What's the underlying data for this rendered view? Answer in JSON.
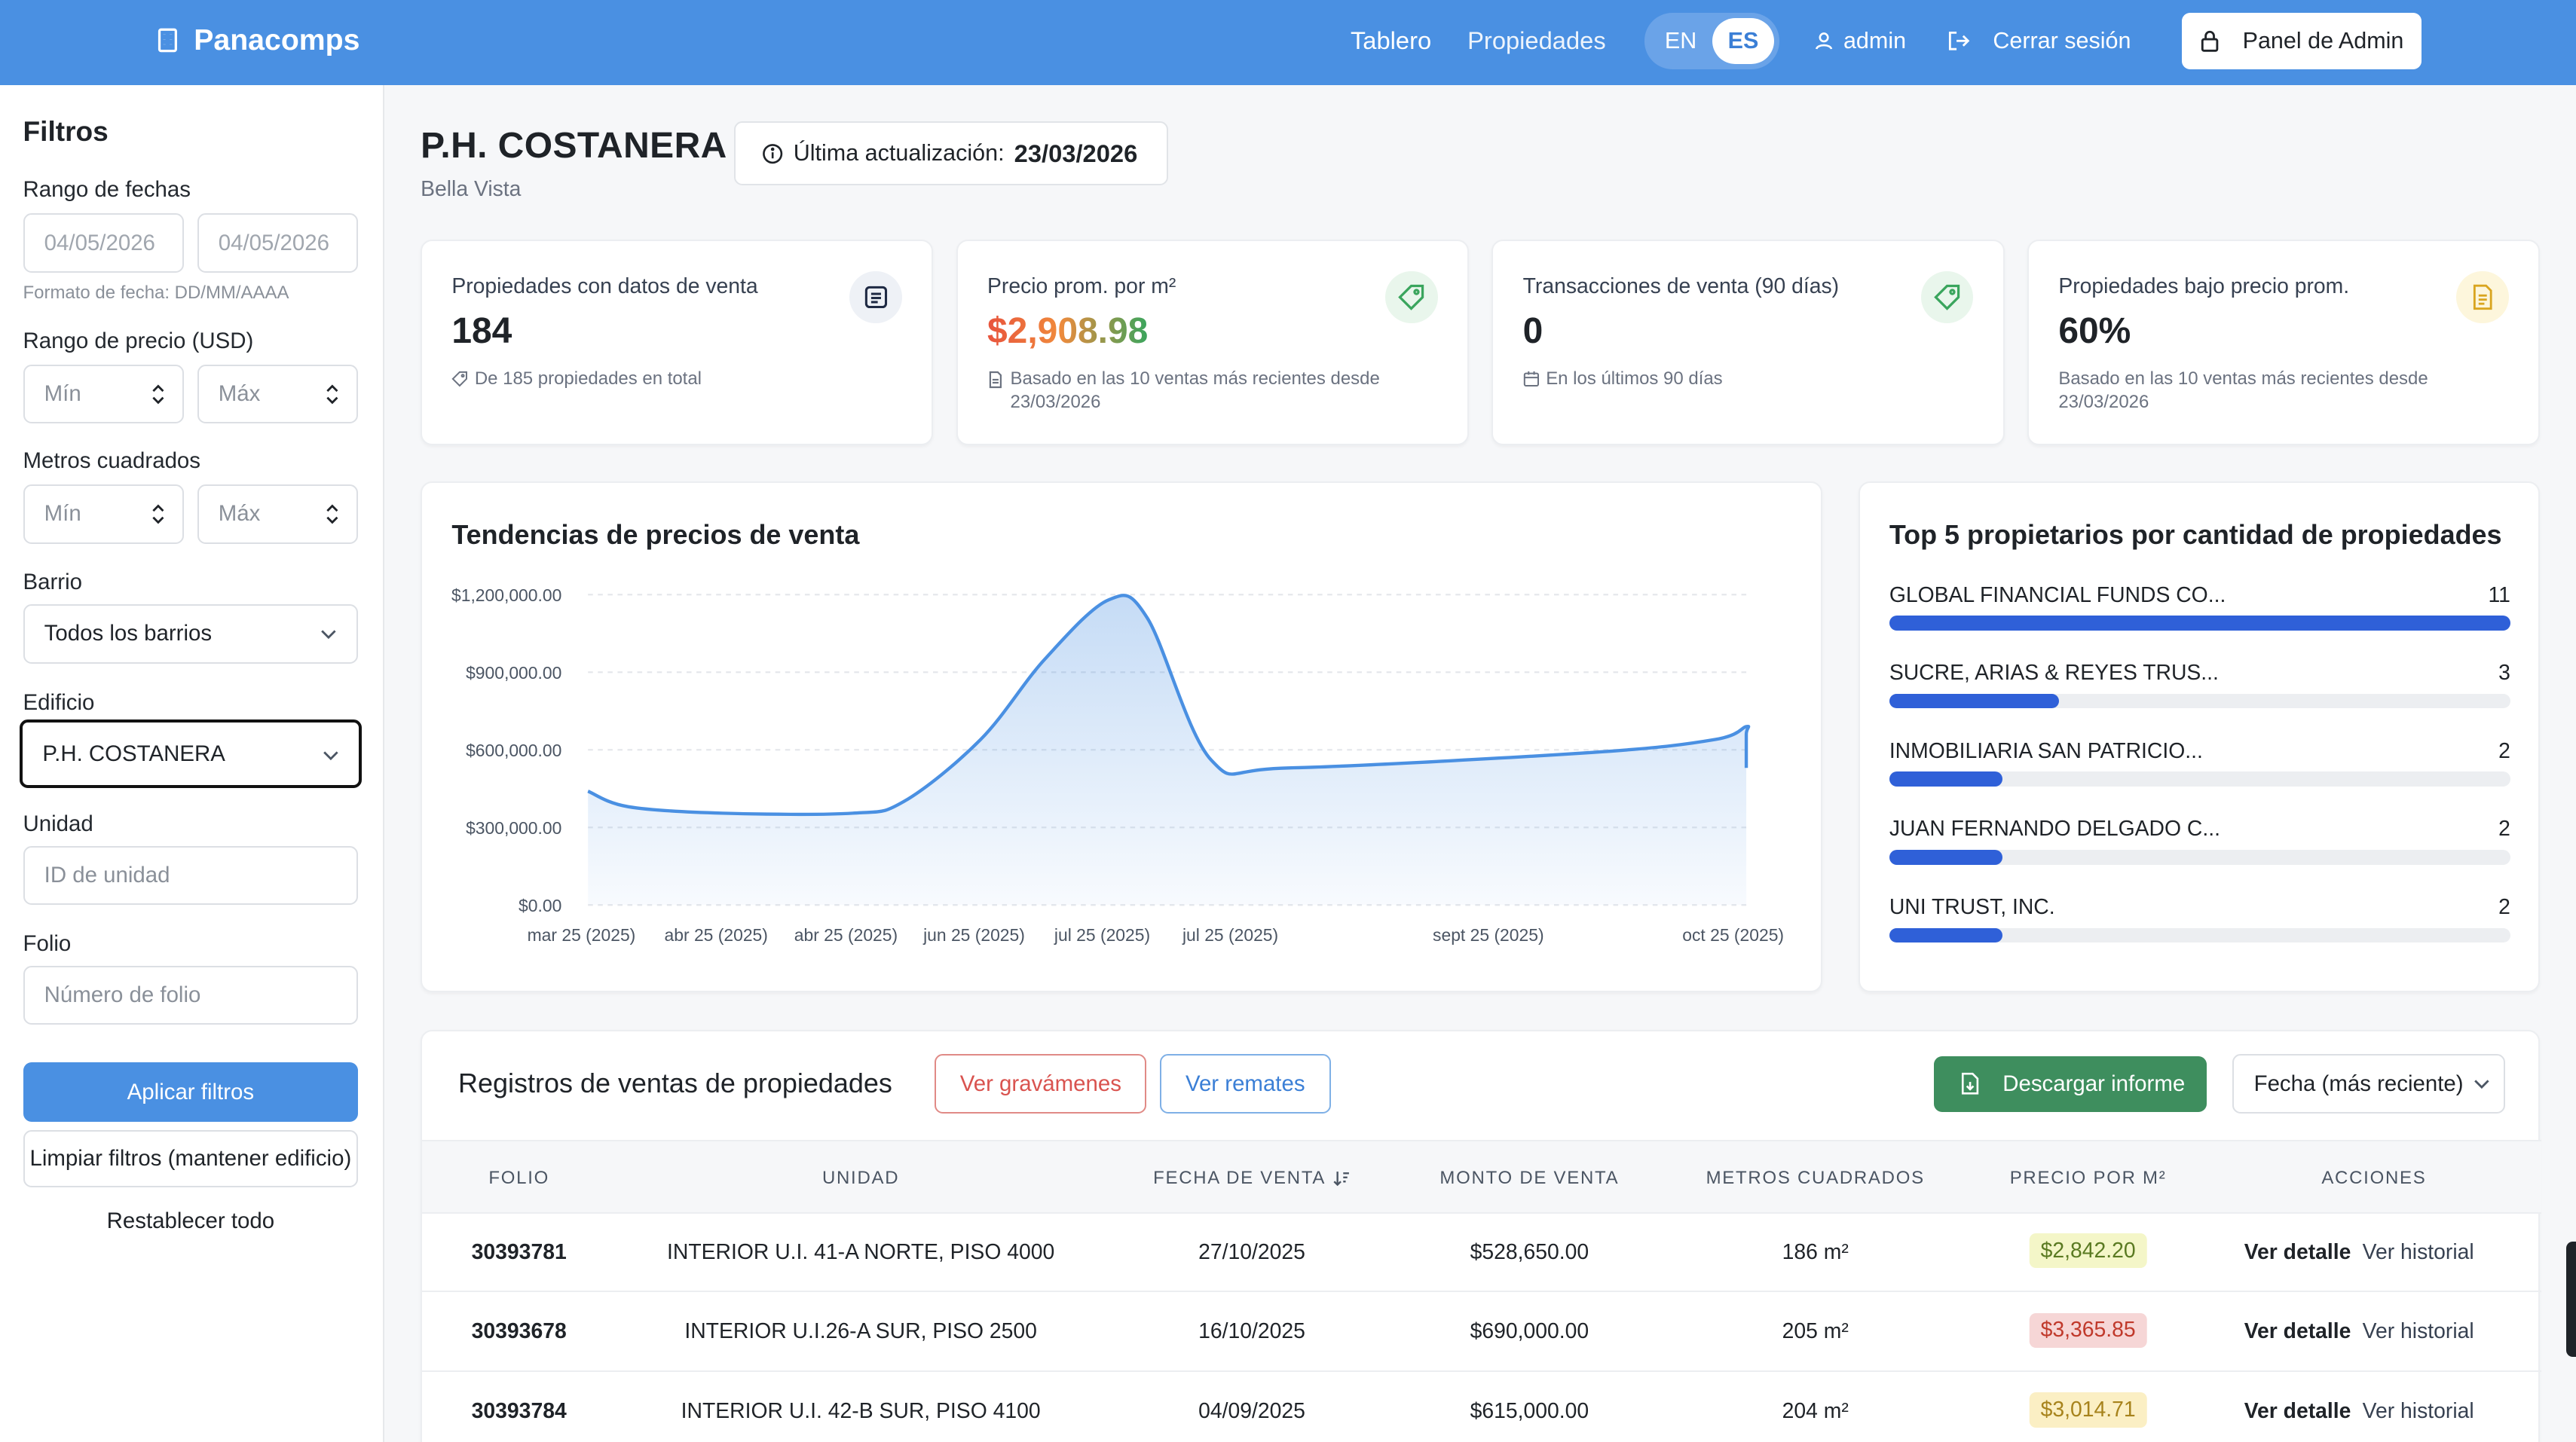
{
  "header": {
    "brand": "Panacomps",
    "nav": [
      "Tablero",
      "Propiedades"
    ],
    "lang": [
      "EN",
      "ES"
    ],
    "lang_active": "ES",
    "user": "admin",
    "logout": "Cerrar sesión",
    "admin_button": "Panel de Admin"
  },
  "filters": {
    "title": "Filtros",
    "date_range_label": "Rango de fechas",
    "date_from_placeholder": "04/05/2026",
    "date_to_placeholder": "04/05/2026",
    "date_hint": "Formato de fecha: DD/MM/AAAA",
    "price_label": "Rango de precio (USD)",
    "min_placeholder": "Mín",
    "max_placeholder": "Máx",
    "sqm_label": "Metros cuadrados",
    "barrio_label": "Barrio",
    "barrio_value": "Todos los barrios",
    "edificio_label": "Edificio",
    "edificio_value": "P.H. COSTANERA",
    "unidad_label": "Unidad",
    "unidad_placeholder": "ID de unidad",
    "folio_label": "Folio",
    "folio_placeholder": "Número de folio",
    "apply": "Aplicar filtros",
    "clear": "Limpiar filtros (mantener edificio)",
    "reset": "Restablecer todo"
  },
  "property": {
    "title": "P.H. COSTANERA",
    "subtitle": "Bella Vista",
    "update_label": "Última actualización:",
    "update_date": "23/03/2026"
  },
  "stats": [
    {
      "label": "Propiedades con datos de venta",
      "value": "184",
      "note": "De 185 propiedades en total"
    },
    {
      "label": "Precio prom. por m²",
      "value": "$2,908.98",
      "note": "Basado en las 10 ventas más recientes desde 23/03/2026"
    },
    {
      "label": "Transacciones de venta (90 días)",
      "value": "0",
      "note": "En los últimos 90 días"
    },
    {
      "label": "Propiedades bajo precio prom.",
      "value": "60%",
      "note": "Basado en las 10 ventas más recientes desde 23/03/2026"
    }
  ],
  "colors": {
    "header_bg": "#4a90e2",
    "price_gradient_start": "#e8543d",
    "price_gradient_end": "#3aa55d",
    "chart_line": "#4a90e2",
    "owner_bar": "#2f60d8",
    "download_button": "#3e8e5e",
    "liens_button": "#d9534f",
    "auctions_button": "#3b7fd6"
  },
  "chart_data": {
    "type": "area",
    "title": "Tendencias de precios de venta",
    "categories": [
      "mar 25 (2025)",
      "abr 25 (2025)",
      "abr 25 (2025)",
      "jun 25 (2025)",
      "jul 25 (2025)",
      "jul 25 (2025)",
      "sept 25 (2025)",
      "oct 25 (2025)"
    ],
    "x_tick_labels": [
      "mar 25 (2025)",
      "abr 25 (2025)",
      "abr 25 (2025)",
      "jun 25 (2025)",
      "jul 25 (2025)",
      "jul 25 (2025)",
      "sept 25 (2025)",
      "oct 25 (2025)"
    ],
    "y_tick_labels": [
      "$0.00",
      "$300,000.00",
      "$600,000.00",
      "$900,000.00",
      "$1,200,000.00"
    ],
    "ylim": [
      0,
      1200000
    ],
    "points": [
      {
        "x_index": 0,
        "y": 440000
      },
      {
        "x_index": 0.3,
        "y": 380000
      },
      {
        "x_index": 1,
        "y": 355000
      },
      {
        "x_index": 2,
        "y": 355000
      },
      {
        "x_index": 2.4,
        "y": 400000
      },
      {
        "x_index": 3,
        "y": 640000
      },
      {
        "x_index": 3.5,
        "y": 950000
      },
      {
        "x_index": 4,
        "y": 1180000
      },
      {
        "x_index": 4.3,
        "y": 1110000
      },
      {
        "x_index": 4.8,
        "y": 560000
      },
      {
        "x_index": 5.2,
        "y": 530000
      },
      {
        "x_index": 6.4,
        "y": 590000
      },
      {
        "x_index": 6.9,
        "y": 640000
      },
      {
        "x_index": 7.3,
        "y": 690000
      },
      {
        "x_index": 7.6,
        "y": 660000
      },
      {
        "x_index": 8.1,
        "y": 530000
      }
    ],
    "grid": true
  },
  "owners": {
    "title": "Top 5 propietarios por cantidad de propiedades",
    "items": [
      {
        "name": "GLOBAL FINANCIAL FUNDS CO...",
        "count": 11
      },
      {
        "name": "SUCRE, ARIAS & REYES TRUS...",
        "count": 3
      },
      {
        "name": "INMOBILIARIA SAN PATRICIO...",
        "count": 2
      },
      {
        "name": "JUAN FERNANDO DELGADO C...",
        "count": 2
      },
      {
        "name": "UNI TRUST, INC.",
        "count": 2
      }
    ]
  },
  "records": {
    "title": "Registros de ventas de propiedades",
    "liens": "Ver gravámenes",
    "auctions": "Ver remates",
    "download": "Descargar informe",
    "sort": "Fecha (más reciente)",
    "columns": [
      "FOLIO",
      "UNIDAD",
      "FECHA DE VENTA",
      "MONTO DE VENTA",
      "METROS CUADRADOS",
      "PRECIO POR M²",
      "ACCIONES"
    ],
    "rows": [
      {
        "folio": "30393781",
        "unidad": "INTERIOR U.I. 41-A NORTE, PISO 4000",
        "fecha": "27/10/2025",
        "monto": "$528,650.00",
        "m2": "186 m²",
        "precio": "$2,842.20",
        "tone": "green"
      },
      {
        "folio": "30393678",
        "unidad": "INTERIOR U.I.26-A SUR, PISO 2500",
        "fecha": "16/10/2025",
        "monto": "$690,000.00",
        "m2": "205 m²",
        "precio": "$3,365.85",
        "tone": "red"
      },
      {
        "folio": "30393784",
        "unidad": "INTERIOR U.I. 42-B SUR, PISO 4100",
        "fecha": "04/09/2025",
        "monto": "$615,000.00",
        "m2": "204 m²",
        "precio": "$3,014.71",
        "tone": "yellow"
      }
    ],
    "action_detail": "Ver detalle",
    "action_history": "Ver historial"
  }
}
